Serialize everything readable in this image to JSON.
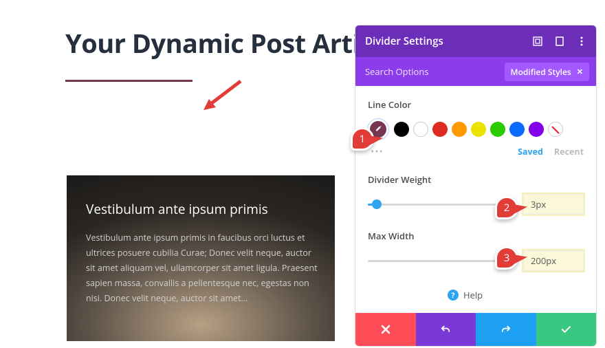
{
  "page": {
    "title": "Your Dynamic Post Articles"
  },
  "card": {
    "title": "Vestibulum ante ipsum primis",
    "body": "Vestibulum ante ipsum primis in faucibus orci luctus et ultrices posuere cubilia Curae; Donec velit neque, auctor sit amet aliquam vel, ullamcorper sit amet ligula. Praesent sapien massa, convallis a pellentesque nec, egestas non nisi. Donec velit neque, auctor sit amet..."
  },
  "panel": {
    "title": "Divider Settings",
    "search_placeholder": "Search Options",
    "tag_label": "Modified Styles"
  },
  "fields": {
    "line_color": {
      "label": "Line Color",
      "saved": "Saved",
      "recent": "Recent"
    },
    "weight": {
      "label": "Divider Weight",
      "value": "3px",
      "percent": 6
    },
    "max_width": {
      "label": "Max Width",
      "value": "200px",
      "percent": 0
    }
  },
  "help": {
    "label": "Help"
  },
  "annotations": {
    "a1": "1",
    "a2": "2",
    "a3": "3"
  }
}
